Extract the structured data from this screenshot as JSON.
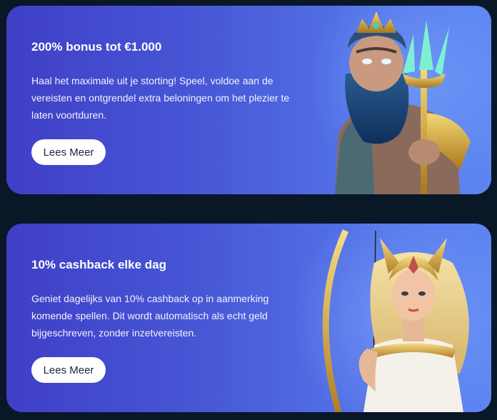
{
  "promos": [
    {
      "title": "200% bonus tot €1.000",
      "description": "Haal het maximale uit je storting! Speel, voldoe aan de vereisten en ontgrendel extra beloningen om het plezier te laten voortduren.",
      "button_label": "Lees Meer",
      "character": "sea-god-with-trident"
    },
    {
      "title": "10% cashback elke dag",
      "description": "Geniet dagelijks van 10% cashback op in aanmerking komende spellen. Dit wordt automatisch als echt geld bijgeschreven, zonder inzetvereisten.",
      "button_label": "Lees Meer",
      "character": "warrior-goddess-with-bow"
    }
  ],
  "colors": {
    "page_bg": "#0a1726",
    "card_gradient_start": "#3f3fc6",
    "card_gradient_end": "#5d86f2",
    "button_bg": "#ffffff",
    "button_text": "#1d2340"
  }
}
